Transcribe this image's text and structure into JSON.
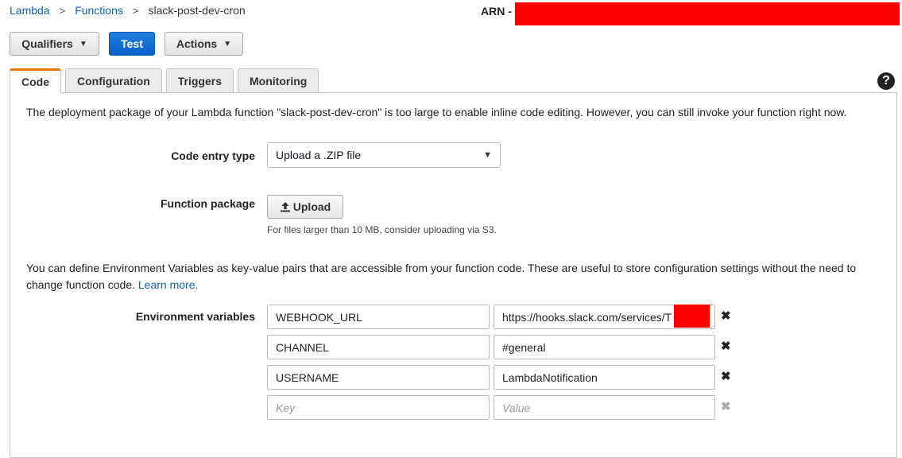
{
  "breadcrumb": {
    "items": [
      "Lambda",
      "Functions",
      "slack-post-dev-cron"
    ],
    "separator": ">"
  },
  "arn_label": "ARN -",
  "toolbar": {
    "qualifiers_label": "Qualifiers",
    "test_label": "Test",
    "actions_label": "Actions"
  },
  "tabs": [
    {
      "label": "Code",
      "active": true
    },
    {
      "label": "Configuration",
      "active": false
    },
    {
      "label": "Triggers",
      "active": false
    },
    {
      "label": "Monitoring",
      "active": false
    }
  ],
  "help_icon": "?",
  "code_tab": {
    "notice": "The deployment package of your Lambda function \"slack-post-dev-cron\" is too large to enable inline code editing. However, you can still invoke your function right now.",
    "entry_type_label": "Code entry type",
    "entry_type_value": "Upload a .ZIP file",
    "package_label": "Function package",
    "upload_label": "Upload",
    "upload_hint": "For files larger than 10 MB, consider uploading via S3.",
    "env_intro": "You can define Environment Variables as key-value pairs that are accessible from your function code. These are useful to store configuration settings without the need to change function code.",
    "learn_more": "Learn more.",
    "env_label": "Environment variables",
    "env_vars": [
      {
        "key": "WEBHOOK_URL",
        "value": "https://hooks.slack.com/services/T"
      },
      {
        "key": "CHANNEL",
        "value": "#general"
      },
      {
        "key": "USERNAME",
        "value": "LambdaNotification"
      }
    ],
    "key_placeholder": "Key",
    "value_placeholder": "Value"
  },
  "colors": {
    "link": "#0b63b5",
    "primary_button": "#0b5fc8",
    "active_tab_accent": "#e77600",
    "redaction": "#ff0000"
  }
}
